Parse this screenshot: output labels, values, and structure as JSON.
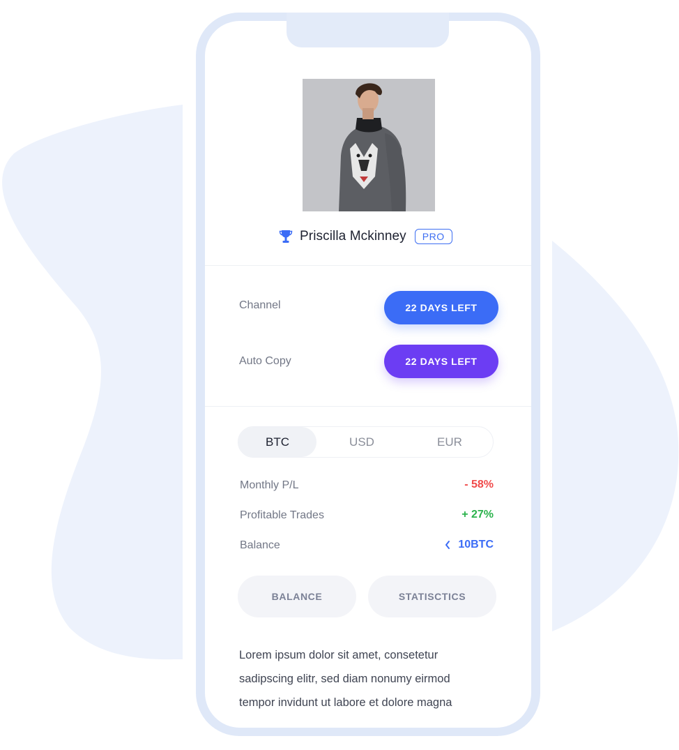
{
  "profile": {
    "name": "Priscilla Mckinney",
    "badge": "PRO"
  },
  "subscriptions": [
    {
      "label": "Channel",
      "status": "22 DAYS LEFT",
      "color": "#3b6cf6"
    },
    {
      "label": "Auto Copy",
      "status": "22 DAYS LEFT",
      "color": "#6c3df3"
    }
  ],
  "currency_tabs": {
    "options": [
      "BTC",
      "USD",
      "EUR"
    ],
    "selected": "BTC"
  },
  "stats": [
    {
      "label": "Monthly P/L",
      "value": "- 58%",
      "color": "#f04a4a"
    },
    {
      "label": "Profitable Trades",
      "value": "+ 27%",
      "color": "#2bb24c"
    },
    {
      "label": "Balance",
      "value": "10BTC",
      "color": "#3b6cf6",
      "icon": "chevron-left-icon"
    }
  ],
  "view_tabs": {
    "balance": "BALANCE",
    "statistics": "STATISCTICS"
  },
  "description": [
    "Lorem ipsum dolor sit amet, consetetur",
    "sadipscing elitr, sed diam nonumy eirmod",
    "tempor invidunt ut labore et dolore magna"
  ],
  "colors": {
    "accent_blue": "#3b6cf6",
    "accent_purple": "#6c3df3",
    "negative": "#f04a4a",
    "positive": "#2bb24c",
    "backdrop": "#edf2fc"
  }
}
